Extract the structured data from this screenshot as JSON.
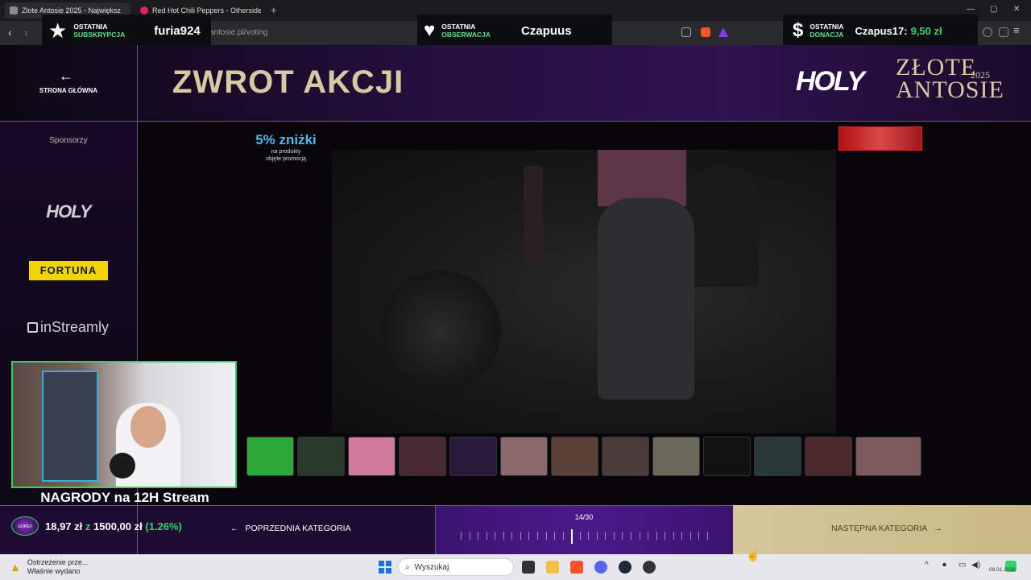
{
  "browser": {
    "tabs": [
      {
        "label": "Złote Antosie 2025 - Największ",
        "close": "✕"
      },
      {
        "label": "Red Hot Chili Peppers - Otherside"
      }
    ],
    "new_tab": "+",
    "url": "antosie.pl/voting"
  },
  "overlays": {
    "subscription": {
      "line1": "OSTATNIA",
      "line2": "SUBSKRYPCJA",
      "name": "furia924"
    },
    "follow": {
      "line1": "OSTATNIA",
      "line2": "OBSERWACJA",
      "name": "Czapuus"
    },
    "donation": {
      "line1": "OSTATNIA",
      "line2": "DONACJA",
      "name": "Czapus17:",
      "amount": "9,50 zł"
    }
  },
  "page": {
    "title": "ZWROT AKCJI",
    "back_label": "STRONA GŁÓWNA",
    "sponsors_title": "Sponsorzy",
    "sponsors": [
      "HOLY",
      "FORTUNA",
      "inStreamly"
    ],
    "logo": {
      "brand": "HOLY",
      "line1": "ZŁOTE",
      "line2": "ANTOSIE",
      "year": "2025"
    },
    "promo": {
      "title": "5% zniżki",
      "sub1": "na produkty",
      "sub2": "objęte promocją"
    }
  },
  "stream": {
    "prize_banner": "NAGRODY na 12H Stream",
    "goal": {
      "logo": "GOPEX",
      "current": "18,97 zł",
      "sep": "z",
      "target": "1500,00 zł",
      "percent": "(1.26%)",
      "progress": 0.0126
    }
  },
  "navigation": {
    "prev_label": "POPRZEDNIA KATEGORIA",
    "next_label": "NASTĘPNA KATEGORIA",
    "counter": "14/30",
    "current": 14,
    "total": 30
  },
  "taskbar": {
    "notification_title": "Ostrzeżenie prze...",
    "notification_sub": "Właśnie wydano",
    "search_placeholder": "Wyszukaj",
    "date": "09.01.2026"
  },
  "colors": {
    "accent_gold": "#d9c9a0",
    "accent_green": "#2fd36a",
    "accent_blue": "#4fb9f0"
  }
}
